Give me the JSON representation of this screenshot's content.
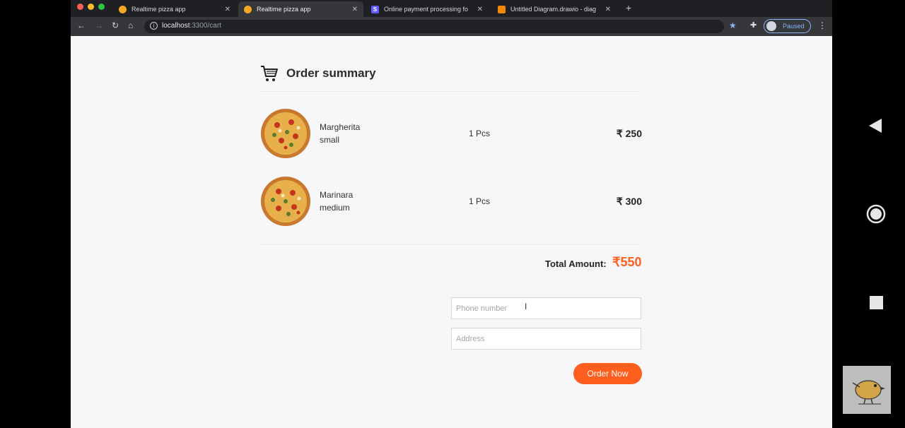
{
  "browser": {
    "tabs": [
      {
        "title": "Realtime pizza app",
        "active": false,
        "favicon": "pizza-favicon"
      },
      {
        "title": "Realtime pizza app",
        "active": true,
        "favicon": "pizza-favicon"
      },
      {
        "title": "Online payment processing fo",
        "active": false,
        "favicon": "stripe-favicon",
        "favicon_letter": "S"
      },
      {
        "title": "Untitled Diagram.drawio - diag",
        "active": false,
        "favicon": "drawio-favicon"
      }
    ],
    "tab_close": "✕",
    "new_tab": "+",
    "url_host": "localhost",
    "url_path": ":3300/cart",
    "profile_status": "Paused"
  },
  "page": {
    "title": "Order summary",
    "items": [
      {
        "name": "Margherita",
        "size": "small",
        "qty": "1 Pcs",
        "price": "₹ 250"
      },
      {
        "name": "Marinara",
        "size": "medium",
        "qty": "1 Pcs",
        "price": "₹ 300"
      }
    ],
    "total_label": "Total Amount:",
    "total_value": "₹550",
    "phone_placeholder": "Phone number",
    "address_placeholder": "Address",
    "order_button": "Order Now"
  },
  "colors": {
    "accent": "#fe5f1e",
    "page_bg": "#f7f7f9",
    "chrome_dark": "#1f2023",
    "chrome_toolbar": "#36373b"
  }
}
